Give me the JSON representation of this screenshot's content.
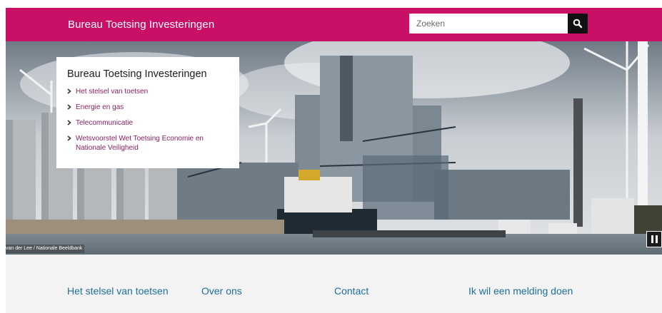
{
  "header": {
    "brand": "Bureau Toetsing Investeringen",
    "search": {
      "placeholder": "Zoeken",
      "button_icon": "search-icon"
    },
    "background_color": "#c90f66"
  },
  "hero": {
    "menu": {
      "title": "Bureau Toetsing Investeringen",
      "items": [
        {
          "label": "Het stelsel van toetsen"
        },
        {
          "label": "Energie en gas"
        },
        {
          "label": "Telecommunicatie"
        },
        {
          "label": "Wetsvoorstel Wet Toetsing Economie en Nationale Veiligheid"
        }
      ]
    },
    "photo_credit": "van der Lee / Nationale Beeldbank",
    "pause_icon": "pause-icon"
  },
  "bottom_nav": {
    "links": [
      {
        "label": "Het stelsel van toetsen"
      },
      {
        "label": "Over ons"
      },
      {
        "label": "Contact"
      },
      {
        "label": "Ik wil een melding doen"
      }
    ]
  },
  "colors": {
    "brand": "#c90f66",
    "menu_link": "#8b2163",
    "nav_link": "#1f6f9a",
    "nav_bg": "#f3f3f3"
  }
}
